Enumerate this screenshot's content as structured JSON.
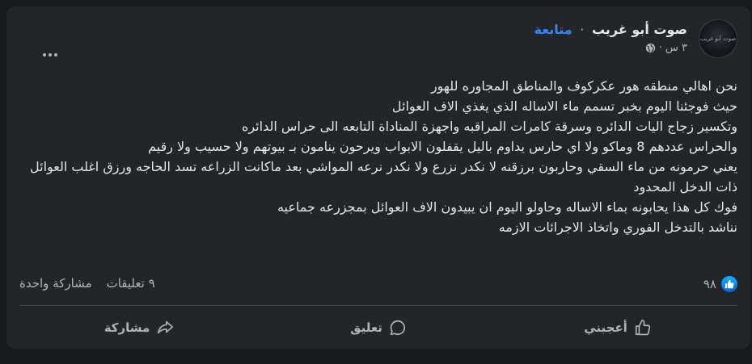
{
  "post": {
    "author": "صوت أبو غريب",
    "follow_label": "متابعة",
    "separator": "·",
    "time": "٣ س",
    "time_separator": "·",
    "avatar_text": "صوت أبو غريب",
    "lines": [
      "نحن اهالي منطقه هور عكركوف والمناطق المجاوره للهور",
      "حيث فوجئنا اليوم بخبر تسمم ماء الاساله الذي يغذي الاف العوائل",
      "وتكسير زجاج اليات الدائره وسرقة كامرات المراقبه واجهزة المناداة التابعه الى حراس الدائره",
      "والحراس عددهم 8 وماكو ولا اي حارس يداوم باليل يقفلون الابواب ويرحون ينامون بـ بيوتهم ولا حسيب ولا رقيم",
      "يعني حرمونه من ماء السقي وحاربون برزقنه لا نكدر نزرع ولا نكدر نرعه المواشي بعد ماكانت الزراعه تسد الحاجه ورزق اغلب العوائل ذات الدخل المحدود",
      "فوك كل هذا يحابونه بماء الاساله وحاولو اليوم ان يبيدون الاف العوائل بمجزرعه جماعيه",
      "نناشد بالتدخل الفوري واتخاذ الاجرائات الازمه"
    ]
  },
  "stats": {
    "reactions_count": "٩٨",
    "comments": "٩ تعليقات",
    "shares": "مشاركة واحدة"
  },
  "actions": {
    "like": "أعجبني",
    "comment": "تعليق",
    "share": "مشاركة"
  },
  "colors": {
    "background": "#18191a",
    "card": "#242526",
    "accent": "#2d88ff",
    "text": "#e4e6eb",
    "secondary": "#b0b3b8"
  }
}
